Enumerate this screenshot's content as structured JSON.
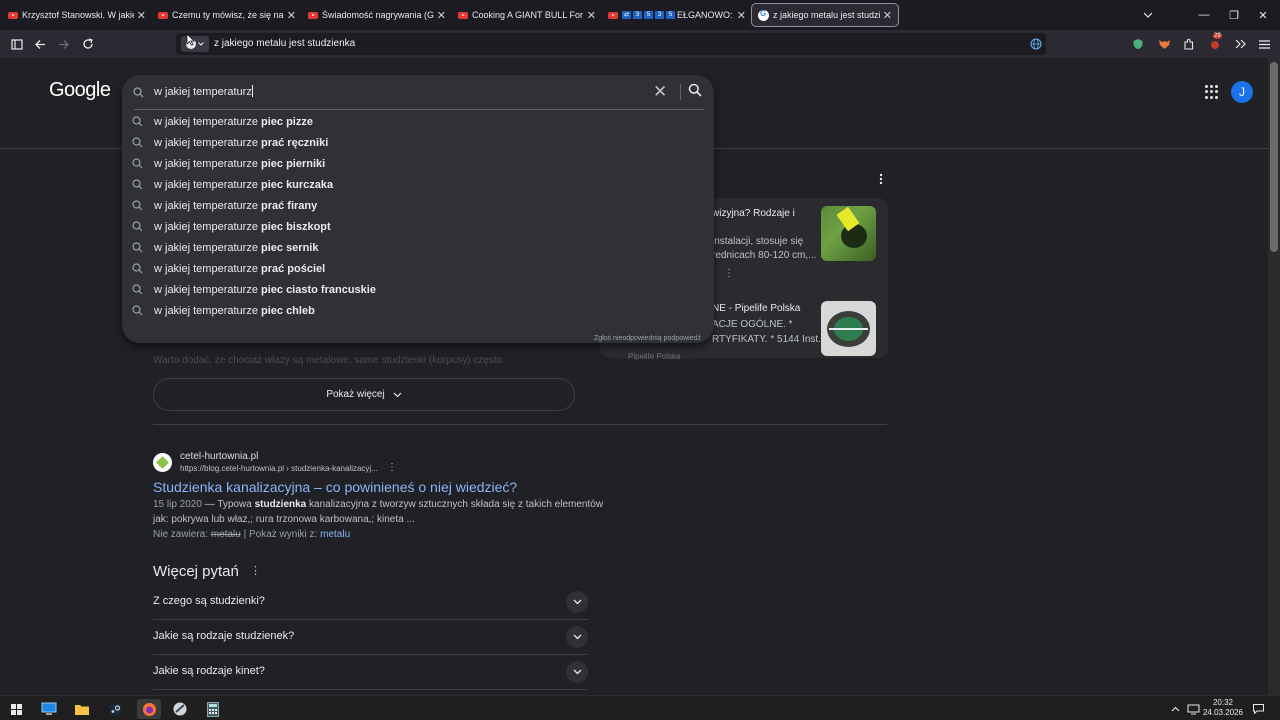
{
  "browser": {
    "tabs": [
      {
        "title": "Krzysztof Stanowski. W jakiej sp",
        "kind": "youtube",
        "active": false
      },
      {
        "title": "Czemu ty mówisz, że się na ciel",
        "kind": "youtube",
        "active": false
      },
      {
        "title": "Świadomość nagrywania (Giełd",
        "kind": "youtube",
        "active": false
      },
      {
        "title": "Cooking A GIANT BULL For A G",
        "kind": "youtube",
        "active": false
      },
      {
        "title": "EŁGANOWO: D",
        "kind": "youtube",
        "active": false
      },
      {
        "title": "z jakiego metalu jest studzienka",
        "kind": "google",
        "active": true
      }
    ],
    "tab4_prefix_badges": [
      "3",
      "5",
      "3",
      "5"
    ],
    "tab_close_glyph": "✕",
    "url": "z jakiego metalu jest studzienka",
    "extension_badge": "29"
  },
  "google": {
    "logo": "Google",
    "avatar_letter": "J",
    "search": {
      "query": "w jakiej temperaturz",
      "suggestion_prefix": "w jakiej temperaturze",
      "suggestions": [
        "piec pizze",
        "prać ręczniki",
        "piec pierniki",
        "piec kurczaka",
        "prać firany",
        "piec biszkopt",
        "piec sernik",
        "prać pościel",
        "piec ciasto francuskie",
        "piec chleb"
      ],
      "report_link": "Zgłoś nieodpowiednią podpowiedź"
    },
    "hidden_snippet": "Warto dodać, że chociaż włazy są metalowe, same studzienki (korpusy) często",
    "show_more": "Pokaż więcej",
    "side_cards": [
      {
        "line1": "wizyjna? Rodzaje i",
        "line2": "instalacji, stosuje się",
        "line3": "rednicach 80-120 cm,..."
      },
      {
        "line1": "NE - Pipelife Polska",
        "line2": "ACJE OGÓLNE. *",
        "line3": "RTYFIKATY. * 5144 Inst...",
        "source": "Pipelife Polska"
      }
    ],
    "result": {
      "site_name": "cetel-hurtownia.pl",
      "site_url": "https://blog.cetel-hurtownia.pl › studzienka-kanalizacyj...",
      "title": "Studzienka kanalizacyjna – co powinieneś o niej wiedzieć?",
      "date": "15 lip 2020",
      "snippet_a": " — Typowa ",
      "snippet_bold": "studzienka",
      "snippet_b": " kanalizacyjna z tworzyw sztucznych składa się z takich elementów",
      "snippet_line2": "jak: pokrywa lub właz,; rura trzonowa karbowana,; kineta ...",
      "missing_label": "Nie zawiera: ",
      "missing_word": "metalu",
      "show_results_label": " | Pokaż wyniki z: ",
      "show_results_link": "metalu"
    },
    "people_also_ask": {
      "title": "Więcej pytań",
      "questions": [
        "Z czego są studzienki?",
        "Jakie są rodzaje studzienek?",
        "Jakie są rodzaje kinet?"
      ]
    }
  },
  "taskbar": {
    "time": "20:32",
    "date": "24.03.2026"
  }
}
